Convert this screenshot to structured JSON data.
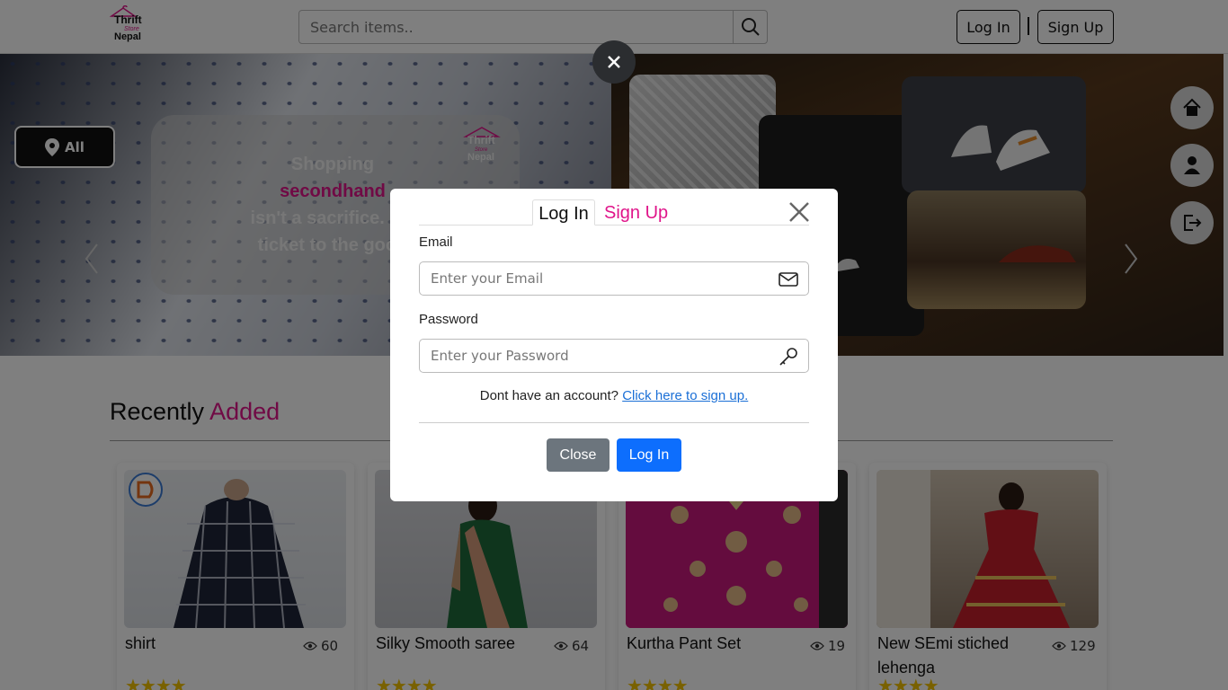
{
  "header": {
    "logo": {
      "line1": "Thrift",
      "line2": "Store",
      "line3": "Nepal"
    },
    "search_placeholder": "Search items..",
    "login_label": "Log In",
    "signup_label": "Sign Up"
  },
  "hero": {
    "location_label": "All",
    "text_line1": "Shopping",
    "text_line2": "secondhand",
    "text_line3": "isn't a sacrifice. It's",
    "text_line4": "ticket to the good"
  },
  "section": {
    "title_plain": "Recently ",
    "title_accent": "Added"
  },
  "cards": [
    {
      "title": "shirt",
      "views": "60",
      "stars": "★★★★"
    },
    {
      "title": "Silky Smooth saree",
      "views": "64",
      "stars": "★★★★"
    },
    {
      "title": "Kurtha Pant Set",
      "views": "19",
      "stars": "★★★★"
    },
    {
      "title": "New SEmi stiched lehenga",
      "views": "129",
      "stars": "★★★★"
    }
  ],
  "modal": {
    "tab_login": "Log In",
    "tab_signup": "Sign Up",
    "email_label": "Email",
    "email_placeholder": "Enter your Email",
    "password_label": "Password",
    "password_placeholder": "Enter your Password",
    "signup_prompt": "Dont have an account?",
    "signup_link": "Click here to sign up.",
    "close_button": "Close",
    "login_button": "Log In"
  },
  "colors": {
    "accent": "#e0158a",
    "primary": "#0d6efd",
    "secondary": "#6c757d"
  }
}
